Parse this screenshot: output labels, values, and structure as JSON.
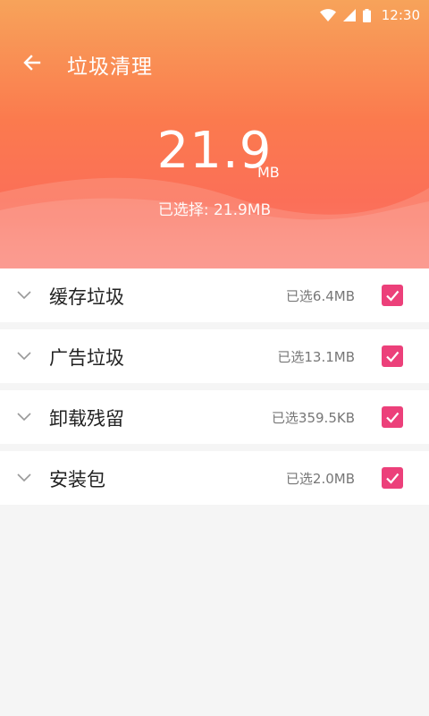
{
  "status_bar": {
    "time": "12:30"
  },
  "toolbar": {
    "title": "垃圾清理",
    "back_icon": "arrow-back-icon"
  },
  "summary": {
    "size_value": "21.9",
    "size_unit": "MB",
    "selected_text": "已选择: 21.9MB"
  },
  "categories": [
    {
      "label": "缓存垃圾",
      "size": "已选6.4MB",
      "checked": true
    },
    {
      "label": "广告垃圾",
      "size": "已选13.1MB",
      "checked": true
    },
    {
      "label": "卸载残留",
      "size": "已选359.5KB",
      "checked": true
    },
    {
      "label": "安装包",
      "size": "已选2.0MB",
      "checked": true
    }
  ],
  "colors": {
    "header_top": "#f7a35a",
    "header_bottom": "#fb6f58",
    "checkbox": "#ec407a",
    "background": "#f5f5f5"
  }
}
